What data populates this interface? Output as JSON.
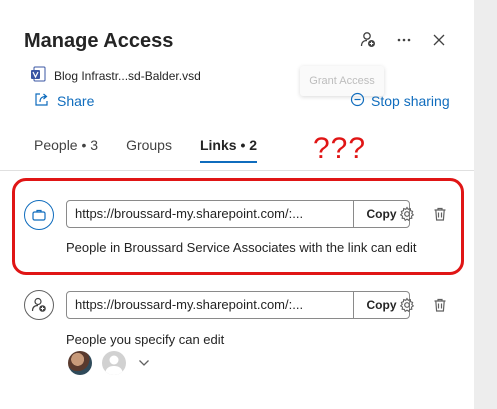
{
  "header": {
    "title": "Manage Access",
    "icons": [
      "grant-access-icon",
      "more-icon",
      "close-icon"
    ]
  },
  "tooltip": {
    "label": "Grant Access"
  },
  "file": {
    "name": "Blog Infrastr...sd-Balder.vsd",
    "icon": "visio-file-icon"
  },
  "actions": {
    "share_label": "Share",
    "stop_sharing_label": "Stop sharing"
  },
  "tabs": [
    {
      "label": "People • 3"
    },
    {
      "label": "Groups"
    },
    {
      "label": "Links • 2",
      "active": true
    }
  ],
  "annotation": {
    "text": "???",
    "color": "#e01515"
  },
  "links": [
    {
      "icon": "briefcase-icon",
      "url": "https://broussard-my.sharepoint.com/:...",
      "copy_label": "Copy",
      "description": "People in Broussard Service Associates with the link can edit"
    },
    {
      "icon": "person-add-icon",
      "url": "https://broussard-my.sharepoint.com/:...",
      "copy_label": "Copy",
      "description": "People you specify can edit"
    }
  ],
  "colors": {
    "accent": "#0f6cbd",
    "highlight": "#e01515"
  }
}
